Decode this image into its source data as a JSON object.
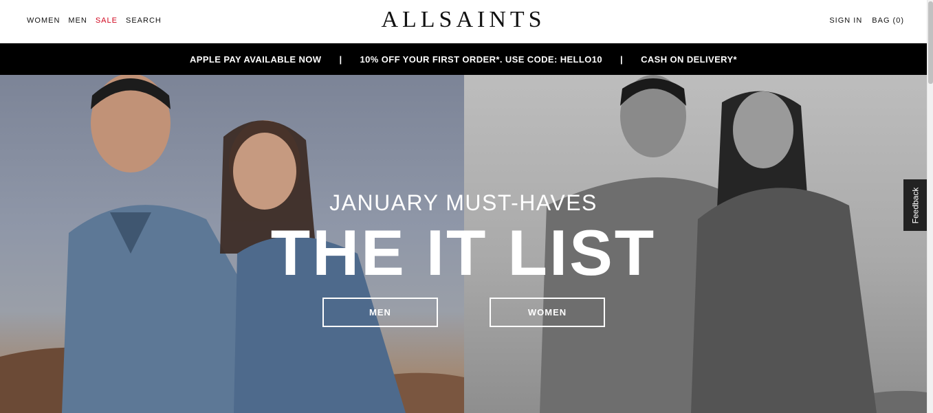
{
  "header": {
    "nav_left": {
      "women": "WOMEN",
      "men": "MEN",
      "sale": "SALE",
      "search": "SEARCH"
    },
    "logo": "ALLSAINTS",
    "nav_right": {
      "sign_in": "SIGN IN",
      "bag": "BAG (0)"
    }
  },
  "promo": {
    "item1": "APPLE PAY AVAILABLE NOW",
    "item2": "10% OFF YOUR FIRST ORDER*. USE CODE: HELLO10",
    "item3": "CASH ON DELIVERY*",
    "separator": "|"
  },
  "hero": {
    "subtitle": "JANUARY MUST-HAVES",
    "title": "THE IT LIST",
    "cta_men": "MEN",
    "cta_women": "WOMEN"
  },
  "feedback": "Feedback",
  "colors": {
    "promo_bg": "#000000",
    "sale": "#d0021b",
    "text": "#111111"
  }
}
